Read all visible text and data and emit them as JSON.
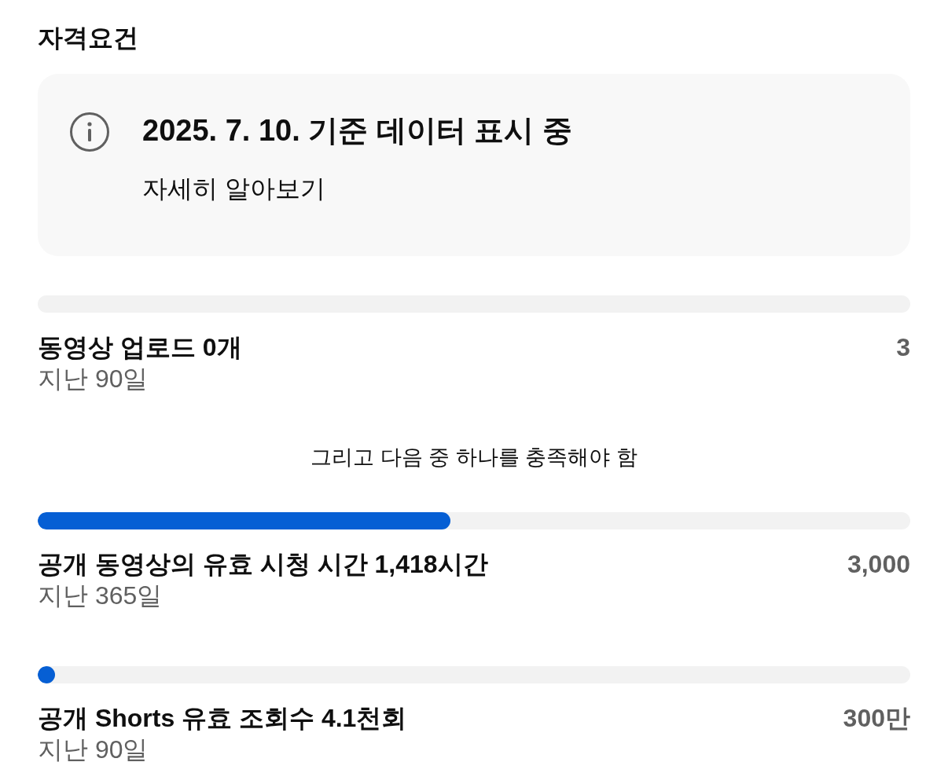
{
  "title": "자격요건",
  "notice": {
    "heading": "2025. 7. 10. 기준 데이터 표시 중",
    "link": "자세히 알아보기"
  },
  "requirements": [
    {
      "label": "동영상 업로드 0개",
      "target": "3",
      "period": "지난 90일"
    }
  ],
  "separator": "그리고 다음 중 하나를 충족해야 함",
  "options": [
    {
      "level": 0.473,
      "label": "공개 동영상의 유효 시청 시간 1,418시간",
      "target": "3,000",
      "period": "지난 365일"
    },
    {
      "level": 0.0014,
      "label": "공개 Shorts 유효 조회수 4.1천회",
      "target": "300만",
      "period": "지난 90일"
    }
  ]
}
